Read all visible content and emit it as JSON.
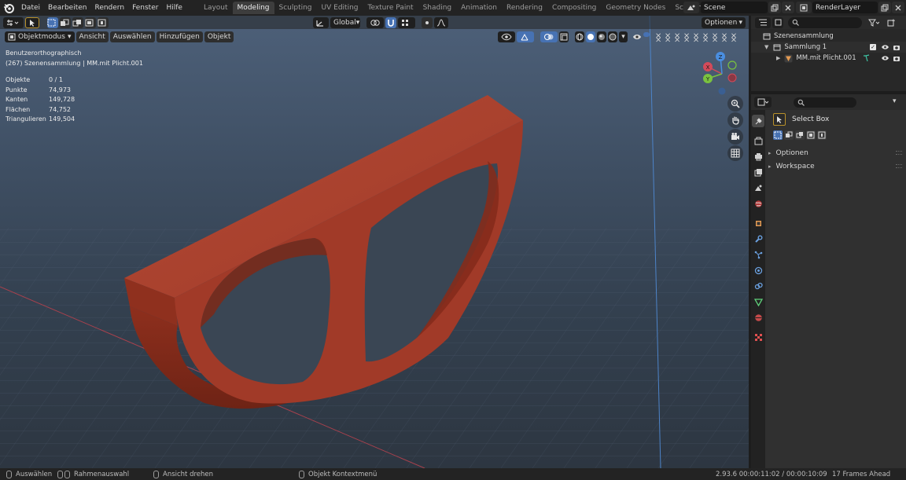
{
  "topbar": {
    "menus": [
      "Datei",
      "Bearbeiten",
      "Rendern",
      "Fenster",
      "Hilfe"
    ],
    "workspaces": [
      "Layout",
      "Modeling",
      "Sculpting",
      "UV Editing",
      "Texture Paint",
      "Shading",
      "Animation",
      "Rendering",
      "Compositing",
      "Geometry Nodes",
      "Scripting"
    ],
    "active_workspace": "Modeling",
    "add_tab_symbol": "+",
    "scene_name": "Scene",
    "render_layer": "RenderLayer"
  },
  "viewport": {
    "mode": "Objektmodus",
    "menus": [
      "Ansicht",
      "Auswählen",
      "Hinzufügen",
      "Objekt"
    ],
    "transform_orientation": "Global",
    "options_label": "Optionen",
    "view_name": "Benutzerorthographisch",
    "collection_line": "(267) Szenensammlung | MM.mit Plicht.001",
    "stats": [
      {
        "label": "Objekte",
        "value": "0 / 1"
      },
      {
        "label": "Punkte",
        "value": "74,973"
      },
      {
        "label": "Kanten",
        "value": "149,728"
      },
      {
        "label": "Flächen",
        "value": "74,752"
      },
      {
        "label": "Triangulieren",
        "value": "149,504"
      }
    ],
    "gizmo_labels": {
      "x": "X",
      "y": "Y",
      "z": "Z"
    },
    "colors": {
      "object": "#a33a28",
      "axis_x": "#d34a5a",
      "axis_y": "#7ac23f",
      "axis_z": "#4a8ee0",
      "accent": "#4772b3"
    }
  },
  "outliner": {
    "rows": [
      {
        "label": "Szenensammlung"
      },
      {
        "label": "Sammlung 1"
      },
      {
        "label": "MM.mit Plicht.001"
      }
    ]
  },
  "properties": {
    "tool_name": "Select Box",
    "panels": [
      "Optionen",
      "Workspace"
    ]
  },
  "statusbar": {
    "items": [
      "Auswählen",
      "Rahmenauswahl",
      "Ansicht drehen",
      "Objekt Kontextmenü"
    ],
    "version_time": "2.93.6  00:00:11:02 / 00:00:10:09",
    "frames_ahead": "17 Frames Ahead"
  }
}
